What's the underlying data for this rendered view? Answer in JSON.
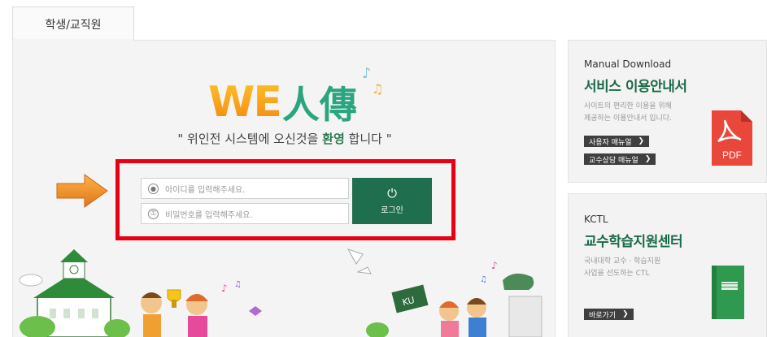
{
  "tab": {
    "label": "학생/교직원"
  },
  "logo": {
    "text_we": "WE",
    "text_han": "人傳"
  },
  "welcome": {
    "pre": "\" 위인전 시스템에 오신것을 ",
    "emphasis": "환영",
    "post": " 합니다 \""
  },
  "login": {
    "id_placeholder": "아이디를 입력해주세요.",
    "pw_placeholder": "비밀번호를 입력해주세요.",
    "button_label": "로그인"
  },
  "manual_card": {
    "subtitle": "Manual Download",
    "title": "서비스 이용안내서",
    "desc_line1": "사이트의 편리한 이용을 위해",
    "desc_line2": "제공하는 이용안내서 입니다.",
    "buttons": [
      "사용자 매뉴얼",
      "교수상담 매뉴얼"
    ],
    "pdf_label": "PDF"
  },
  "kctl_card": {
    "subtitle": "KCTL",
    "title": "교수학습지원센터",
    "desc_line1": "국내대학 교수 · 학습지원",
    "desc_line2": "사업을 선도하는 CTL",
    "button": "바로가기"
  },
  "scene": {
    "sign_text": "KU"
  },
  "colors": {
    "accent_green": "#1f6e4e",
    "highlight_red": "#e60012",
    "pdf_red": "#e9473a",
    "book_green": "#2f9a4f"
  }
}
